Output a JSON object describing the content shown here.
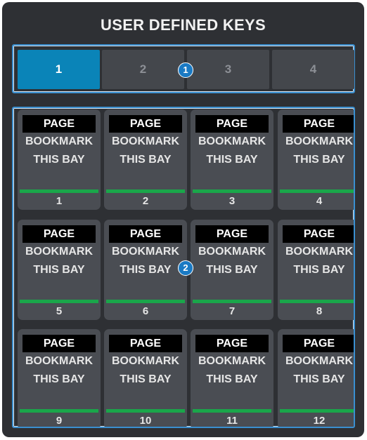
{
  "panel": {
    "title": "USER DEFINED KEYS"
  },
  "banks": [
    {
      "label": "1",
      "active": true
    },
    {
      "label": "2",
      "active": false
    },
    {
      "label": "3",
      "active": false
    },
    {
      "label": "4",
      "active": false
    }
  ],
  "keys": [
    {
      "tag": "PAGE",
      "line1": "BOOKMARK",
      "line2": "THIS BAY",
      "number": "1"
    },
    {
      "tag": "PAGE",
      "line1": "BOOKMARK",
      "line2": "THIS BAY",
      "number": "2"
    },
    {
      "tag": "PAGE",
      "line1": "BOOKMARK",
      "line2": "THIS BAY",
      "number": "3"
    },
    {
      "tag": "PAGE",
      "line1": "BOOKMARK",
      "line2": "THIS BAY",
      "number": "4"
    },
    {
      "tag": "PAGE",
      "line1": "BOOKMARK",
      "line2": "THIS BAY",
      "number": "5"
    },
    {
      "tag": "PAGE",
      "line1": "BOOKMARK",
      "line2": "THIS BAY",
      "number": "6"
    },
    {
      "tag": "PAGE",
      "line1": "BOOKMARK",
      "line2": "THIS BAY",
      "number": "7"
    },
    {
      "tag": "PAGE",
      "line1": "BOOKMARK",
      "line2": "THIS BAY",
      "number": "8"
    },
    {
      "tag": "PAGE",
      "line1": "BOOKMARK",
      "line2": "THIS BAY",
      "number": "9"
    },
    {
      "tag": "PAGE",
      "line1": "BOOKMARK",
      "line2": "THIS BAY",
      "number": "10"
    },
    {
      "tag": "PAGE",
      "line1": "BOOKMARK",
      "line2": "THIS BAY",
      "number": "11"
    },
    {
      "tag": "PAGE",
      "line1": "BOOKMARK",
      "line2": "THIS BAY",
      "number": "12"
    }
  ],
  "callouts": {
    "bank_selector": "1",
    "key_grid": "2"
  },
  "colors": {
    "active_tab": "#0a84b8",
    "indicator_bar": "#1aa64a",
    "callout_badge": "#1a7ac4",
    "highlight_frame": "#3a8fd0"
  }
}
